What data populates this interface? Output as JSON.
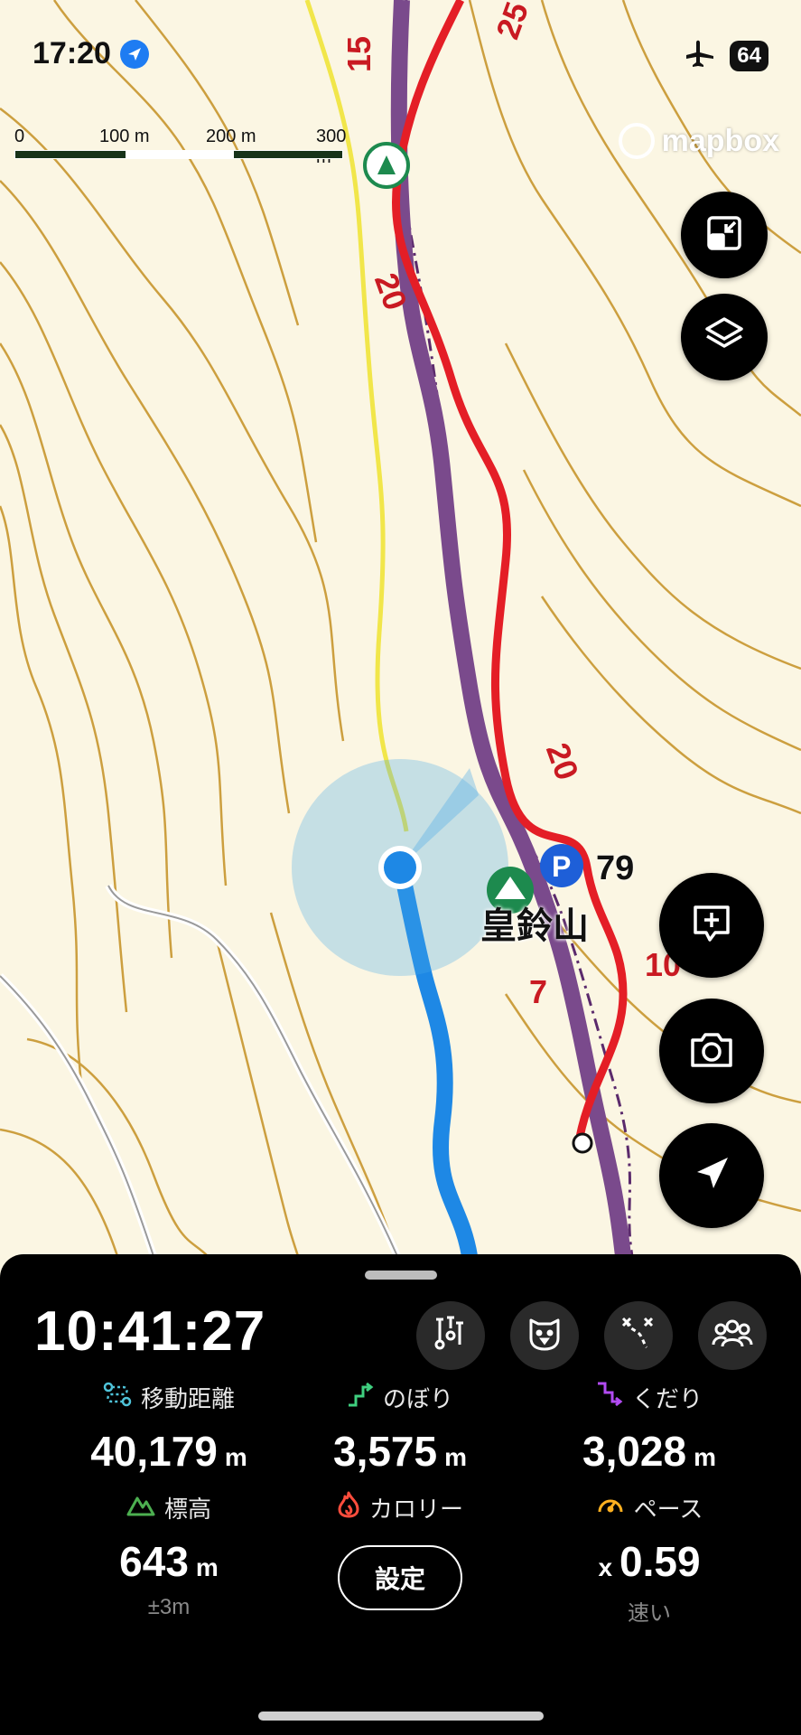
{
  "status_bar": {
    "time": "17:20",
    "battery": "64"
  },
  "scale": {
    "labels": [
      "0",
      "100 m",
      "200 m",
      "300 m"
    ]
  },
  "attribution": "mapbox",
  "map_labels": {
    "place": "皇鈴山",
    "elevation": "79",
    "route_numbers": [
      "15",
      "25",
      "20",
      "20",
      "10",
      "7"
    ]
  },
  "map_buttons": {
    "shrink": "shrink-map-icon",
    "layers": "layers-icon",
    "add_note": "add-note-icon",
    "camera": "camera-icon",
    "locate": "locate-arrow-icon"
  },
  "panel": {
    "elapsed_time": "10:41:27",
    "tools": [
      "flask-pins-icon",
      "dog-face-icon",
      "route-icon",
      "group-icon"
    ],
    "stats": [
      {
        "label": "移動距離",
        "value": "40,179",
        "unit": "m",
        "icon_color": "#4fc3d9"
      },
      {
        "label": "のぼり",
        "value": "3,575",
        "unit": "m",
        "icon_color": "#3fcf7f"
      },
      {
        "label": "くだり",
        "value": "3,028",
        "unit": "m",
        "icon_color": "#b24bf3"
      },
      {
        "label": "標高",
        "value": "643",
        "unit": "m",
        "sub": "±3m",
        "icon_color": "#4caf50"
      },
      {
        "label": "カロリー",
        "icon_color": "#ff4d3d"
      },
      {
        "label": "ペース",
        "prefix": "x",
        "value": "0.59",
        "sub": "速い",
        "icon_color": "#ffb020"
      }
    ],
    "settings_label": "設定"
  },
  "colors": {
    "track_purple": "#7a4a8c",
    "route_red": "#e41e26",
    "location_blue": "#1e88e5",
    "contour": "#c8962e"
  }
}
